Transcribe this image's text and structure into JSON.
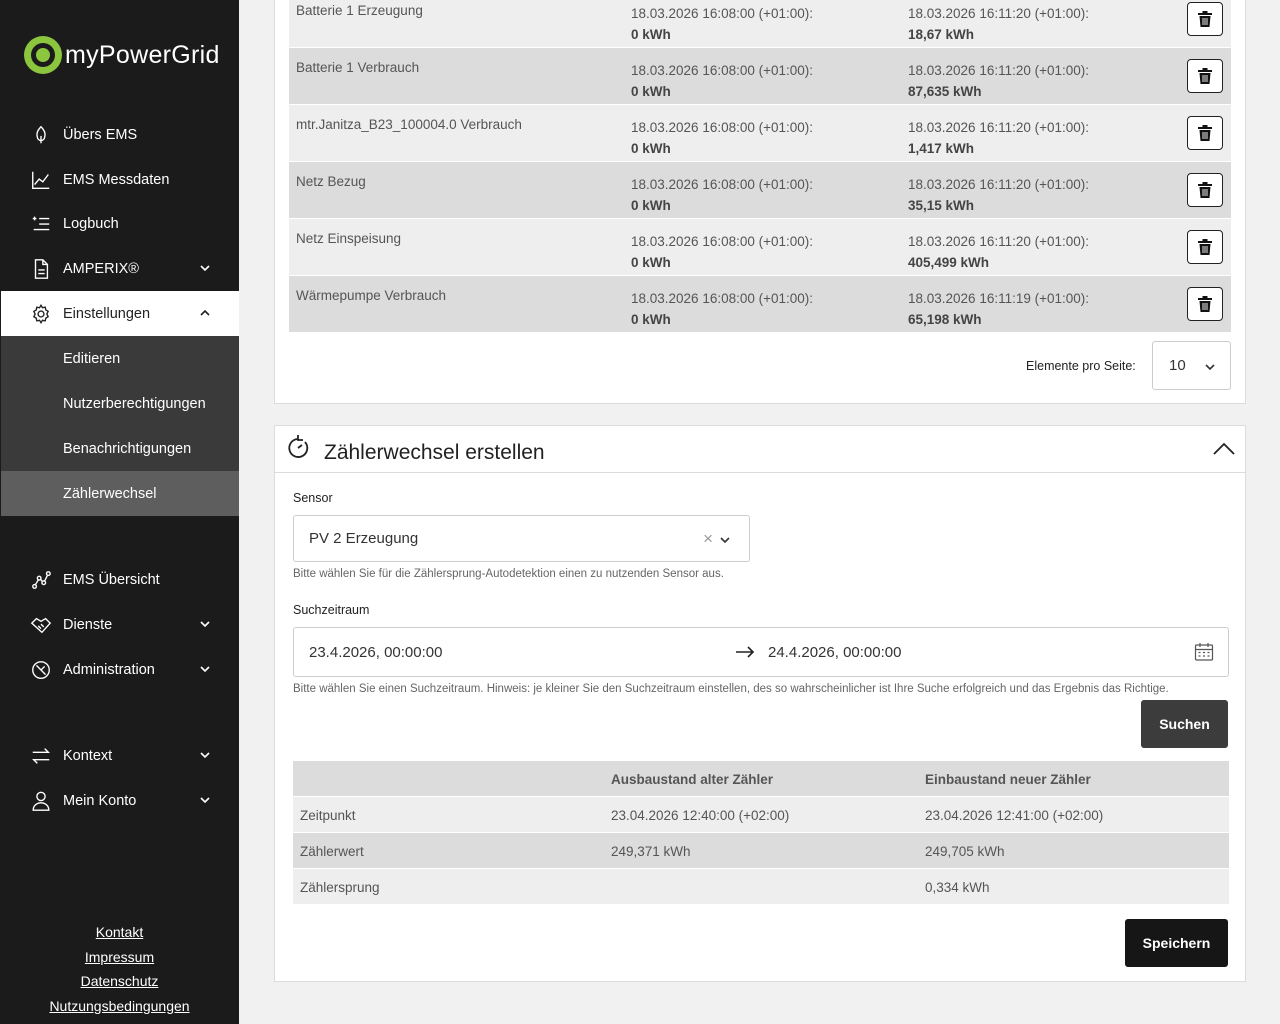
{
  "brand": {
    "name": "myPowerGrid"
  },
  "nav": {
    "items": [
      {
        "label": "Übers EMS"
      },
      {
        "label": "EMS Messdaten"
      },
      {
        "label": "Logbuch"
      },
      {
        "label": "AMPERIX®"
      },
      {
        "label": "Einstellungen"
      },
      {
        "label": "EMS Übersicht"
      },
      {
        "label": "Dienste"
      },
      {
        "label": "Administration"
      },
      {
        "label": "Kontext"
      },
      {
        "label": "Mein Konto"
      }
    ],
    "sub": [
      {
        "label": "Editieren"
      },
      {
        "label": "Nutzerberechtigungen"
      },
      {
        "label": "Benachrichtigungen"
      },
      {
        "label": "Zählerwechsel"
      }
    ]
  },
  "footer": {
    "links": [
      {
        "label": "Kontakt"
      },
      {
        "label": "Impressum"
      },
      {
        "label": "Datenschutz"
      },
      {
        "label": "Nutzungsbedingungen"
      }
    ]
  },
  "meters": {
    "rows": [
      {
        "name": "Batterie 1 Erzeugung",
        "start_time": "18.03.2026 16:08:00 (+01:00):",
        "start_value": "0 kWh",
        "end_time": "18.03.2026 16:11:20 (+01:00):",
        "end_value": "18,67 kWh"
      },
      {
        "name": "Batterie 1 Verbrauch",
        "start_time": "18.03.2026 16:08:00 (+01:00):",
        "start_value": "0 kWh",
        "end_time": "18.03.2026 16:11:20 (+01:00):",
        "end_value": "87,635 kWh"
      },
      {
        "name": "mtr.Janitza_B23_100004.0 Verbrauch",
        "start_time": "18.03.2026 16:08:00 (+01:00):",
        "start_value": "0 kWh",
        "end_time": "18.03.2026 16:11:20 (+01:00):",
        "end_value": "1,417 kWh"
      },
      {
        "name": "Netz Bezug",
        "start_time": "18.03.2026 16:08:00 (+01:00):",
        "start_value": "0 kWh",
        "end_time": "18.03.2026 16:11:20 (+01:00):",
        "end_value": "35,15 kWh"
      },
      {
        "name": "Netz Einspeisung",
        "start_time": "18.03.2026 16:08:00 (+01:00):",
        "start_value": "0 kWh",
        "end_time": "18.03.2026 16:11:20 (+01:00):",
        "end_value": "405,499 kWh"
      },
      {
        "name": "Wärmepumpe Verbrauch",
        "start_time": "18.03.2026 16:08:00 (+01:00):",
        "start_value": "0 kWh",
        "end_time": "18.03.2026 16:11:19 (+01:00):",
        "end_value": "65,198 kWh"
      }
    ],
    "pager_label": "Elemente pro Seite:",
    "pager_value": "10"
  },
  "form": {
    "title": "Zählerwechsel erstellen",
    "sensor_label": "Sensor",
    "sensor_value": "PV 2 Erzeugung",
    "sensor_hint": "Bitte wählen Sie für die Zählersprung-Autodetektion einen zu nutzenden Sensor aus.",
    "range_label": "Suchzeitraum",
    "range_from": "23.4.2026, 00:00:00",
    "range_to": "24.4.2026, 00:00:00",
    "range_hint": "Bitte wählen Sie einen Suchzeitraum. Hinweis: je kleiner Sie den Suchzeitraum einstellen, des so wahrscheinlicher ist Ihre Suche erfolgreich und das Ergebnis das Richtige.",
    "search_label": "Suchen",
    "save_label": "Speichern"
  },
  "result": {
    "headers": [
      "",
      "Ausbaustand alter Zähler",
      "Einbaustand neuer Zähler"
    ],
    "rows": [
      {
        "label": "Zeitpunkt",
        "old": "23.04.2026 12:40:00 (+02:00)",
        "new": "23.04.2026 12:41:00 (+02:00)"
      },
      {
        "label": "Zählerwert",
        "old": "249,371 kWh",
        "new": "249,705 kWh"
      },
      {
        "label": "Zählersprung",
        "old": "",
        "new": "0,334 kWh"
      }
    ]
  }
}
